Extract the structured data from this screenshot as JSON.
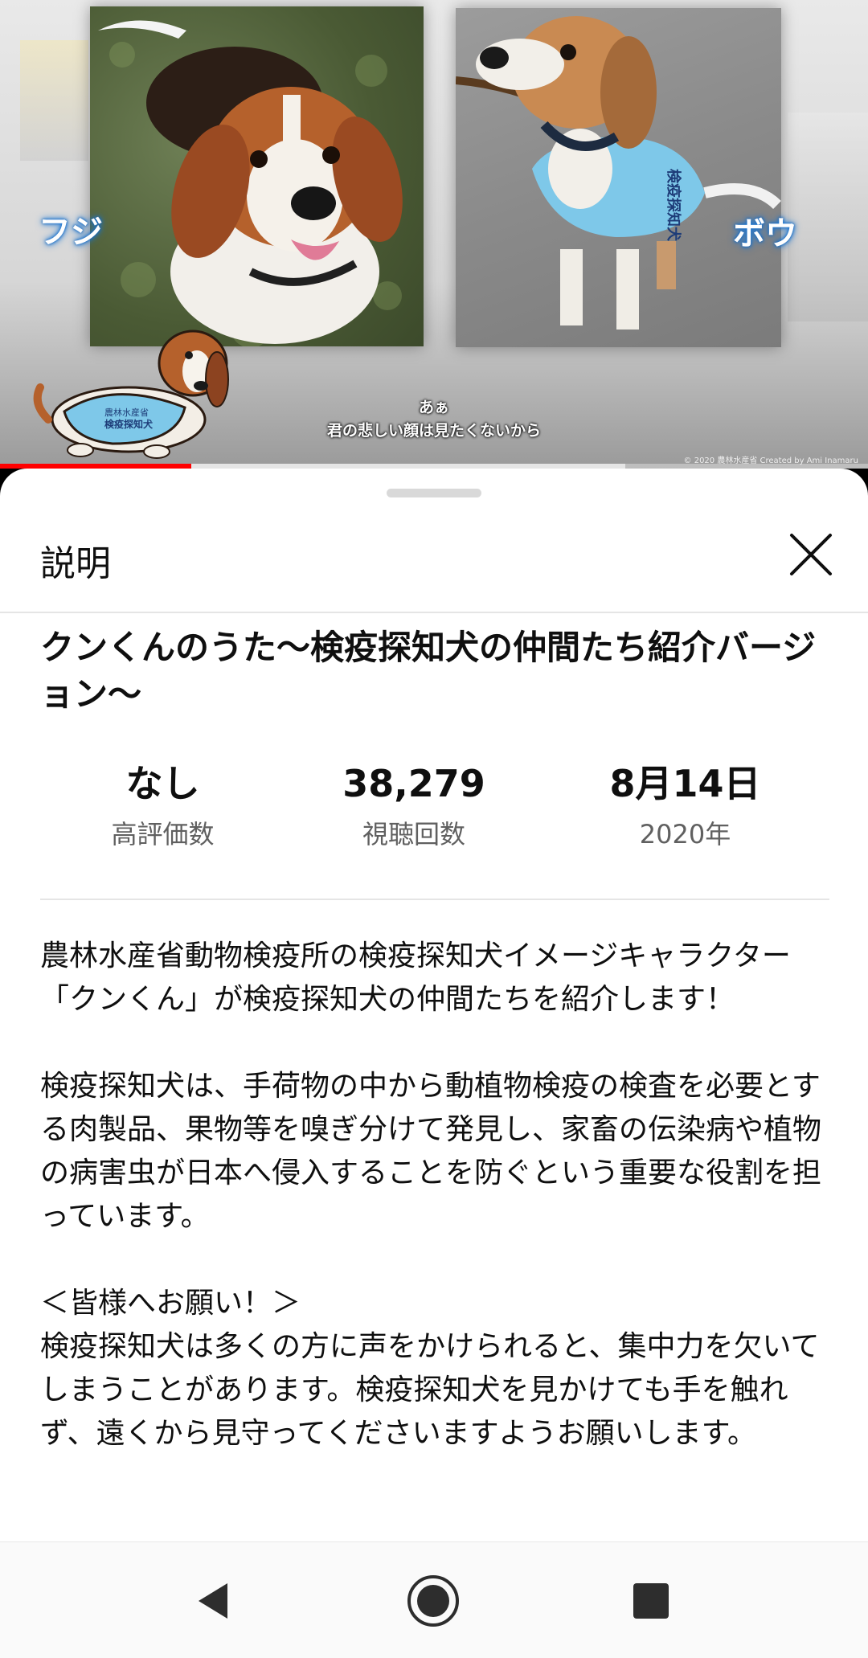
{
  "video": {
    "caption_left": "フジ",
    "caption_right": "ボウ",
    "subtitle_line1": "あぁ",
    "subtitle_line2": "君の悲しい顔は見たくないから",
    "copyright": "© 2020 農林水産省 Created by Ami Inamaru",
    "progress_played": 0.22,
    "progress_buffered": 0.72,
    "progress_color": "#ff0000"
  },
  "sheet": {
    "title": "説明",
    "close_icon": "close-icon",
    "video_title": "クンくんのうた〜検疫探知犬の仲間たち紹介バージョン〜",
    "stats": [
      {
        "value": "なし",
        "label": "高評価数"
      },
      {
        "value": "38,279",
        "label": "視聴回数"
      },
      {
        "value": "8月14日",
        "label": "2020年"
      }
    ],
    "description": "農林水産省動物検疫所の検疫探知犬イメージキャラクター「クンくん」が検疫探知犬の仲間たちを紹介します！\n\n検疫探知犬は、手荷物の中から動植物検疫の検査を必要とする肉製品、果物等を嗅ぎ分けて発見し、家畜の伝染病や植物の病害虫が日本へ侵入することを防ぐという重要な役割を担っています。\n\n＜皆様へお願い！＞\n検疫探知犬は多くの方に声をかけられると、集中力を欠いてしまうことがあります。検疫探知犬を見かけても手を触れず、遠くから見守ってくださいますようお願いします。"
  },
  "navbar": {
    "back_icon": "back-triangle-icon",
    "home_icon": "home-circle-icon",
    "recent_icon": "recent-apps-square-icon"
  }
}
